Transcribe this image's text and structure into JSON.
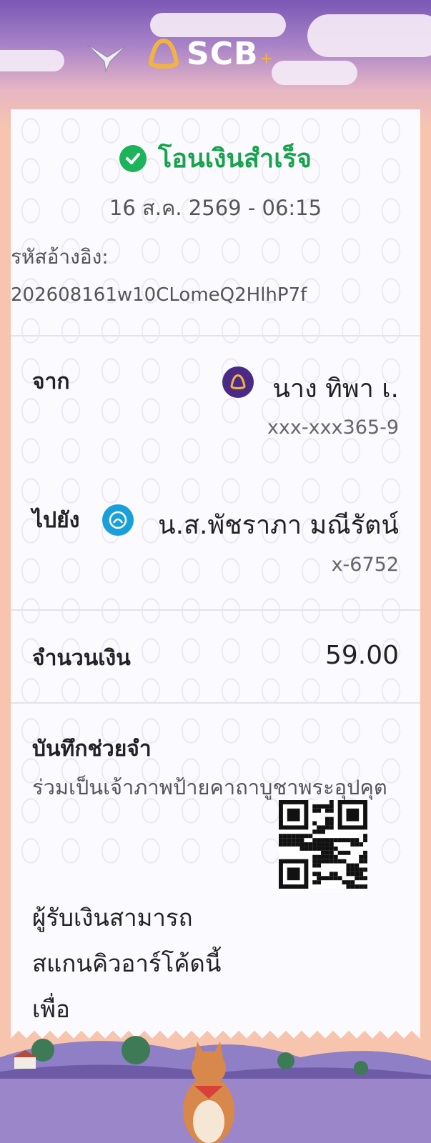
{
  "header": {
    "brand": "SCB",
    "brand_plus": "+"
  },
  "receipt": {
    "status": "โอนเงินสำเร็จ",
    "datetime": "16 ส.ค. 2569 - 06:15",
    "ref_label": "รหัสอ้างอิง:",
    "ref_value": "202608161w10CLomeQ2HlhP7f",
    "from": {
      "label": "จาก",
      "name": "นาง ทิพา เ.",
      "account": "xxx-xxx365-9"
    },
    "to": {
      "label": "ไปยัง",
      "name": "น.ส.พัชราภา มณีรัตน์",
      "account": "x-6752"
    },
    "amount": {
      "label": "จำนวนเงิน",
      "value": "59.00"
    },
    "memo": {
      "label": "บันทึกช่วยจำ",
      "text": "ร่วมเป็นเจ้าภาพป้ายคาถาบูชาพระอุปคุต"
    },
    "qr_note": "ผู้รับเงินสามารถสแกนคิวอาร์โค้ดนี้เพื่อ"
  },
  "colors": {
    "success": "#17a34d",
    "scb_purple": "#4b2a85",
    "kbank_blue": "#1aa0d8"
  }
}
